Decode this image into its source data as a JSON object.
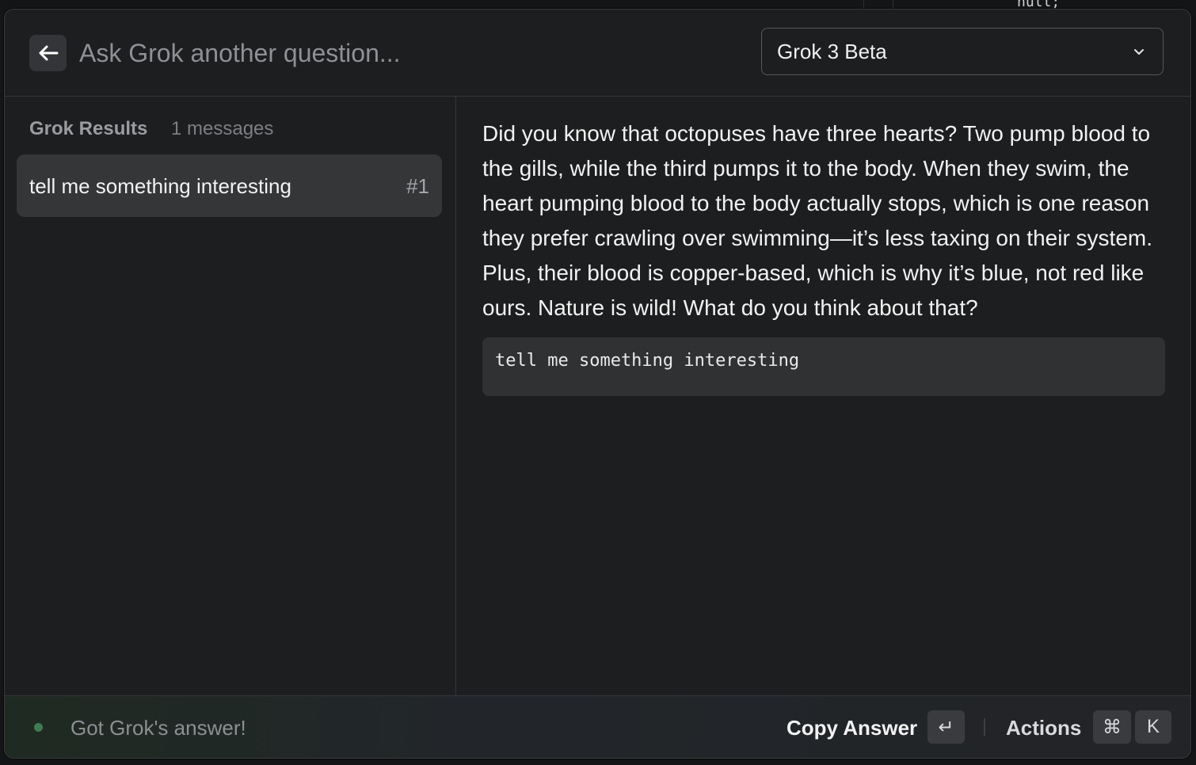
{
  "header": {
    "search_placeholder": "Ask Grok another question...",
    "model_selected": "Grok 3 Beta"
  },
  "sidebar": {
    "section_title": "Grok Results",
    "message_count": "1 messages",
    "items": [
      {
        "label": "tell me something interesting",
        "index": "#1"
      }
    ]
  },
  "content": {
    "answer": "Did you know that octopuses have three hearts? Two pump blood to the gills, while the third pumps it to the body. When they swim, the heart pumping blood to the body actually stops, which is one reason they prefer crawling over swimming—it’s less taxing on their system. Plus, their blood is copper-based, which is why it’s blue, not red like ours. Nature is wild! What do you think about that?",
    "prompt": "tell me something interesting"
  },
  "footer": {
    "status": "Got Grok's answer!",
    "copy_answer_label": "Copy Answer",
    "copy_answer_key": "↵",
    "actions_label": "Actions",
    "actions_key_modifier": "⌘",
    "actions_key": "K",
    "status_color": "#3e7d52"
  },
  "background_editor": {
    "code_fragment": "null;"
  }
}
